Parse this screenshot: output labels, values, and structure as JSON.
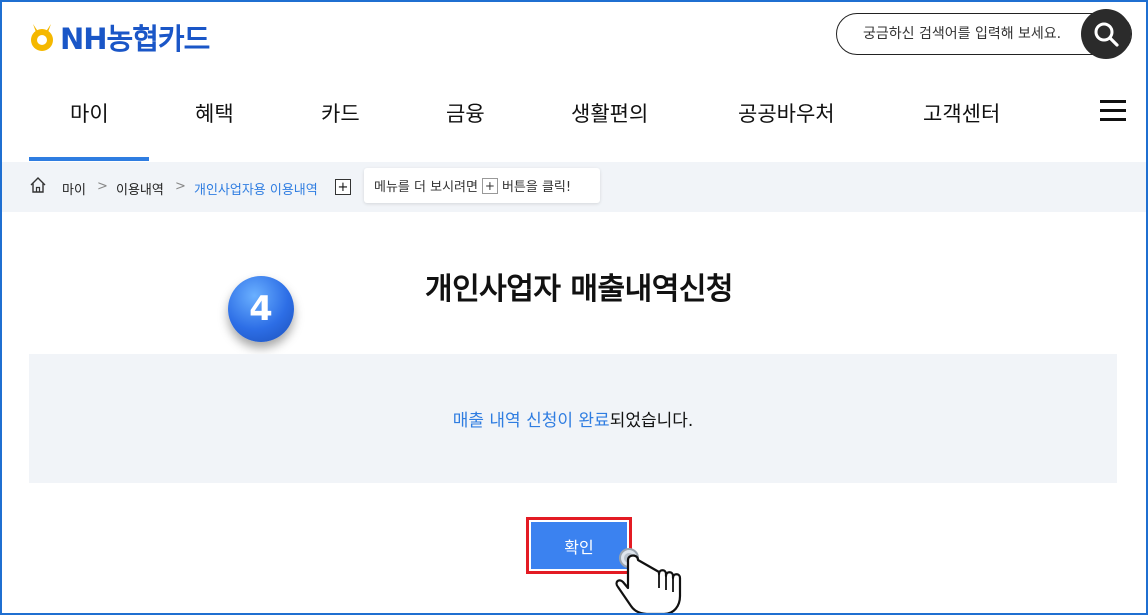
{
  "header": {
    "logo_text": "NH농협카드",
    "search_placeholder": "궁금하신 검색어를 입력해 보세요."
  },
  "nav": {
    "items": [
      "마이",
      "혜택",
      "카드",
      "금융",
      "생활편의",
      "공공바우처",
      "고객센터"
    ],
    "active": "마이"
  },
  "breadcrumb": {
    "items": [
      "마이",
      "이용내역",
      "개인사업자용 이용내역"
    ],
    "separator": ">",
    "plus_label": "+",
    "tip_before": "메뉴를 더 보시려면",
    "tip_plus": "+",
    "tip_after": "버튼을 클릭!"
  },
  "main": {
    "step_number": "4",
    "title": "개인사업자 매출내역신청",
    "message_highlight": "매출 내역 신청이 완료",
    "message_rest": " 되었습니다.",
    "confirm_label": "확인"
  },
  "colors": {
    "brand_blue": "#1a56c7",
    "accent_blue": "#2f7de1",
    "button_blue": "#3b82f0",
    "highlight_red": "#e31b23",
    "panel_bg": "#f1f4f8",
    "logo_yellow": "#f5b800"
  },
  "icons": {
    "logo": "nh-logo-icon",
    "search": "search-icon",
    "menu": "hamburger-menu-icon",
    "home": "home-icon",
    "cursor": "hand-pointer-icon"
  }
}
